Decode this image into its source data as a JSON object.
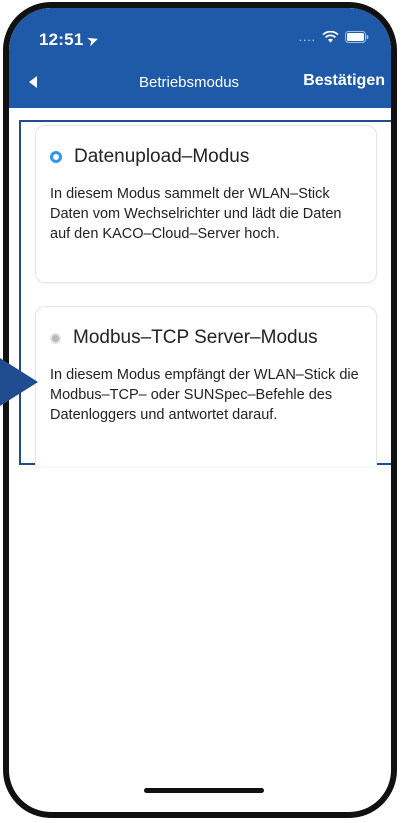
{
  "status_bar": {
    "time": "12:51",
    "signal": "....",
    "icons": [
      "location-arrow-icon",
      "wifi-icon",
      "battery-icon"
    ]
  },
  "nav": {
    "title": "Betriebsmodus",
    "confirm_label": "Bestätigen",
    "back_icon": "back-arrow-icon"
  },
  "modes": [
    {
      "title": "Datenupload–Modus",
      "selected": true,
      "description": "In diesem Modus sammelt der WLAN–Stick Daten vom Wechselrichter und lädt die Daten auf den KACO–Cloud–Server hoch."
    },
    {
      "title": "Modbus–TCP Server–Modus",
      "selected": false,
      "description": "In diesem Modus empfängt der WLAN–Stick die Modbus–TCP– oder SUNSpec–Befehle des Datenloggers und antwortet darauf."
    }
  ],
  "colors": {
    "header_bg": "#1e5aa7",
    "radio_selected": "#2e95f0",
    "highlight": "#1f4d8f"
  }
}
